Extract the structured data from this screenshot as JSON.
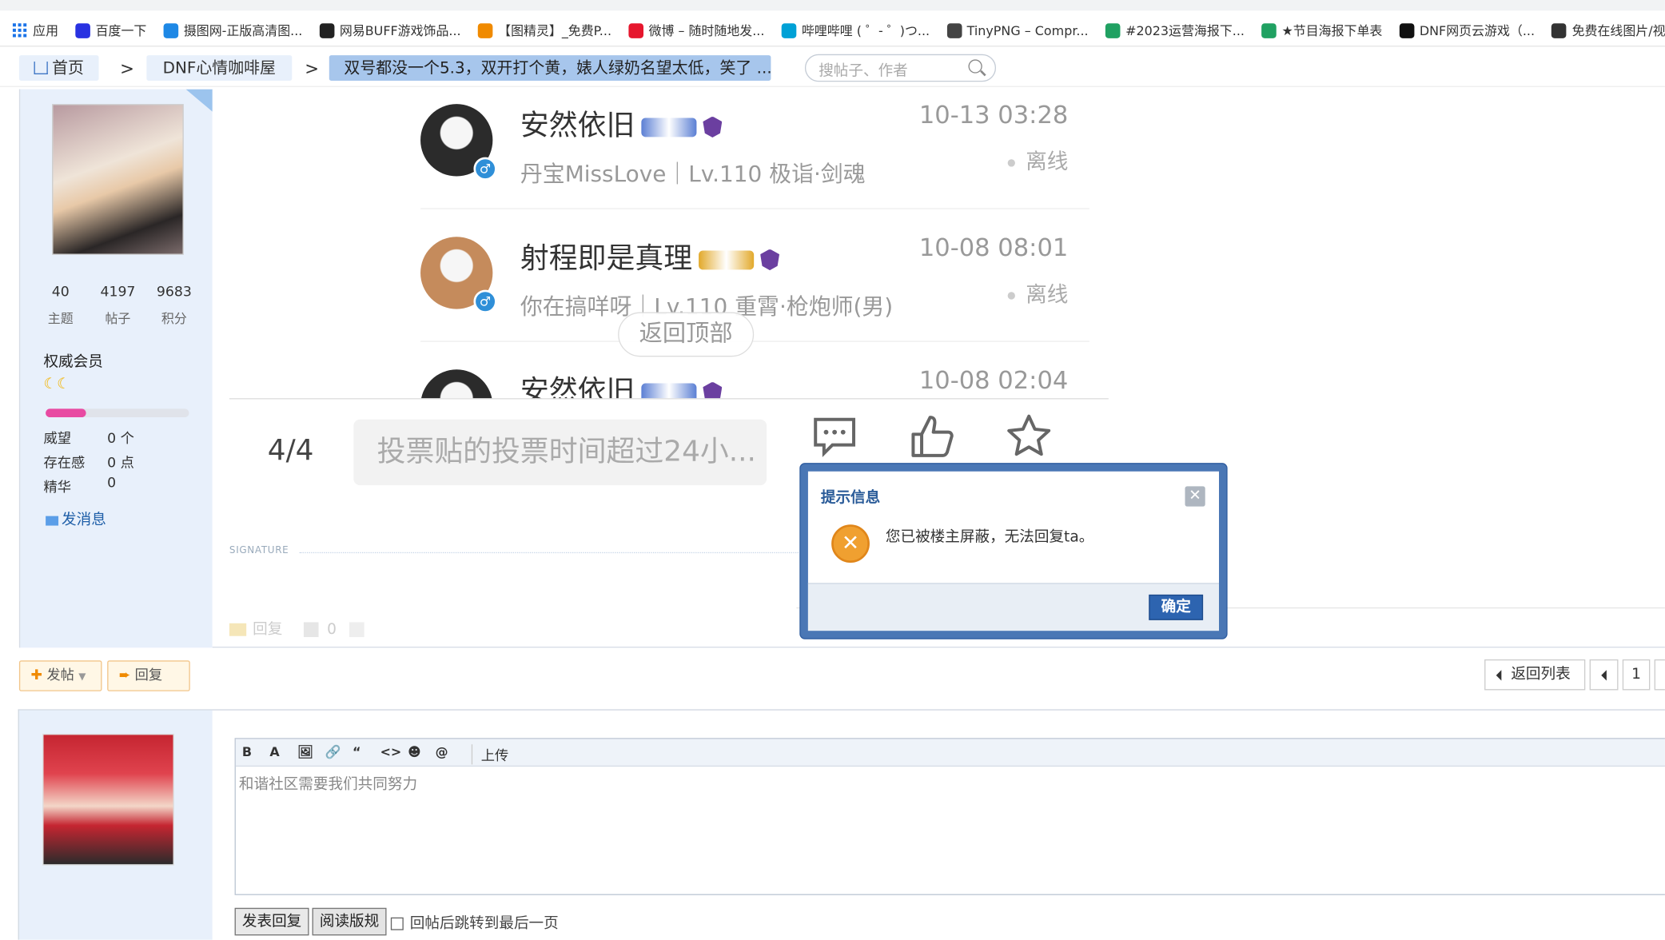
{
  "bookmarks": [
    {
      "label": "应用",
      "icon": "apps-icon",
      "color": "#1a73e8"
    },
    {
      "label": "百度一下",
      "icon": "baidu-icon",
      "color": "#2932e1"
    },
    {
      "label": "摄图网-正版高清图...",
      "icon": "shetu-icon",
      "color": "#1e88e5"
    },
    {
      "label": "网易BUFF游戏饰品...",
      "icon": "buff-icon",
      "color": "#222"
    },
    {
      "label": "【图精灵】_免费P...",
      "icon": "tujingling-icon",
      "color": "#f08a00"
    },
    {
      "label": "微博 – 随时随地发...",
      "icon": "weibo-icon",
      "color": "#e6162d"
    },
    {
      "label": "哔哩哔哩 ( ゜- ゜)つ...",
      "icon": "bilibili-icon",
      "color": "#00a1d6"
    },
    {
      "label": "TinyPNG – Compr...",
      "icon": "tinypng-icon",
      "color": "#444"
    },
    {
      "label": "#2023运营海报下...",
      "icon": "sheet-icon",
      "color": "#20a162"
    },
    {
      "label": "★节目海报下单表",
      "icon": "sheet-icon",
      "color": "#20a162"
    },
    {
      "label": "DNF网页云游戏（...",
      "icon": "dnf-cloud-icon",
      "color": "#111"
    },
    {
      "label": "免费在线图片/视频...",
      "icon": "duck-icon",
      "color": "#333"
    }
  ],
  "breadcrumb": {
    "home": "首页",
    "forum": "DNF心情咖啡屋",
    "thread": "双号都没一个5.3，双开打个黄，婊人绿奶名望太低，笑了 ...",
    "sep": ">"
  },
  "search": {
    "placeholder": "搜帖子、作者"
  },
  "author": {
    "stats": [
      {
        "value": "40",
        "label": "主题"
      },
      {
        "value": "4197",
        "label": "帖子"
      },
      {
        "value": "9683",
        "label": "积分"
      }
    ],
    "rank": "权威会员",
    "moons": "☾☾",
    "level_progress": 0.28,
    "details": [
      {
        "label": "威望",
        "value": "0 个"
      },
      {
        "label": "存在感",
        "value": "0 点"
      },
      {
        "label": "精华",
        "value": "0"
      }
    ],
    "send_message": "发消息"
  },
  "screenshot": {
    "replies": [
      {
        "name": "安然依旧",
        "badge_color": "#5b7fd4",
        "sub": "丹宝MissLove｜Lv.110 极诣·剑魂",
        "time": "10-13 03:28",
        "status": "离线",
        "sex": "♂",
        "avatar_color": "#2b2b2b"
      },
      {
        "name": "射程即是真理",
        "badge_color": "#e2a92b",
        "sub": "你在搞咩呀｜Lv.110 重霄·枪炮师(男)",
        "time": "10-08 08:01",
        "status": "离线",
        "sex": "♂",
        "avatar_color": "#c58b5c"
      },
      {
        "name": "安然依旧",
        "badge_color": "#5b7fd4",
        "sub": "",
        "time": "10-08 02:04",
        "status": "",
        "sex": "",
        "avatar_color": "#2b2b2b"
      }
    ],
    "back_top": "返回顶部",
    "page": "4/4",
    "input_placeholder": "投票贴的投票时间超过24小...",
    "icons": [
      "comment-icon",
      "thumbs-up-icon",
      "star-icon"
    ]
  },
  "signature_label": "SIGNATURE",
  "post_actions": {
    "reply": "回复",
    "likes": "0"
  },
  "dialog": {
    "title": "提示信息",
    "message": "您已被楼主屏蔽，无法回复ta。",
    "ok": "确定"
  },
  "toolbar": {
    "post": "发帖",
    "reply": "回复",
    "back_list": "返回列表",
    "page": "1"
  },
  "editor": {
    "tools": [
      "B",
      "A",
      "🖼",
      "🔗",
      "“",
      "<>",
      "☻",
      "@"
    ],
    "upload": "上传",
    "text": "和谐社区需要我们共同努力",
    "submit": "发表回复",
    "rules": "阅读版规",
    "jump_label": "回帖后跳转到最后一页"
  }
}
